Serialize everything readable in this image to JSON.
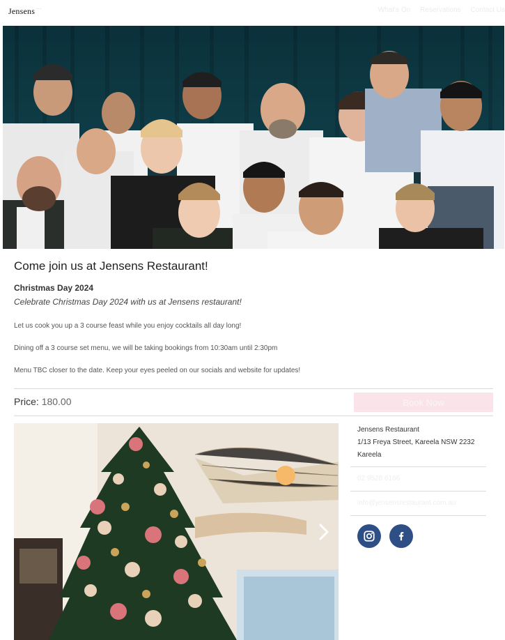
{
  "header": {
    "logo": "Jensens",
    "logo_mark": "",
    "nav": [
      "What's On",
      "Reservations",
      "Contact Us"
    ]
  },
  "event": {
    "title": "Come join us at Jensens Restaurant!",
    "subtitle": "Christmas Day 2024",
    "tagline": "Celebrate Christmas Day 2024 with us at Jensens restaurant!",
    "paragraphs": [
      "Let us cook you up a 3 course feast while you enjoy cocktails all day long!",
      "Dining off a 3 course set menu, we will be taking bookings from 10:30am until 2:30pm",
      "Menu TBC closer to the date. Keep your eyes peeled on our socials and website for updates!"
    ],
    "price_label": "Price:",
    "price_value": "180.00",
    "book_label": "Book Now"
  },
  "venue": {
    "name": "Jensens Restaurant",
    "address": "1/13 Freya Street, Kareela NSW 2232",
    "suburb": "Kareela",
    "phone": "02 9528 6166",
    "email": "info@jensensrestaurant.com.au"
  },
  "social_icons": [
    "instagram-icon",
    "facebook-icon"
  ],
  "colors": {
    "accent_button": "#fbe3ea",
    "social": "#2e4f86"
  }
}
